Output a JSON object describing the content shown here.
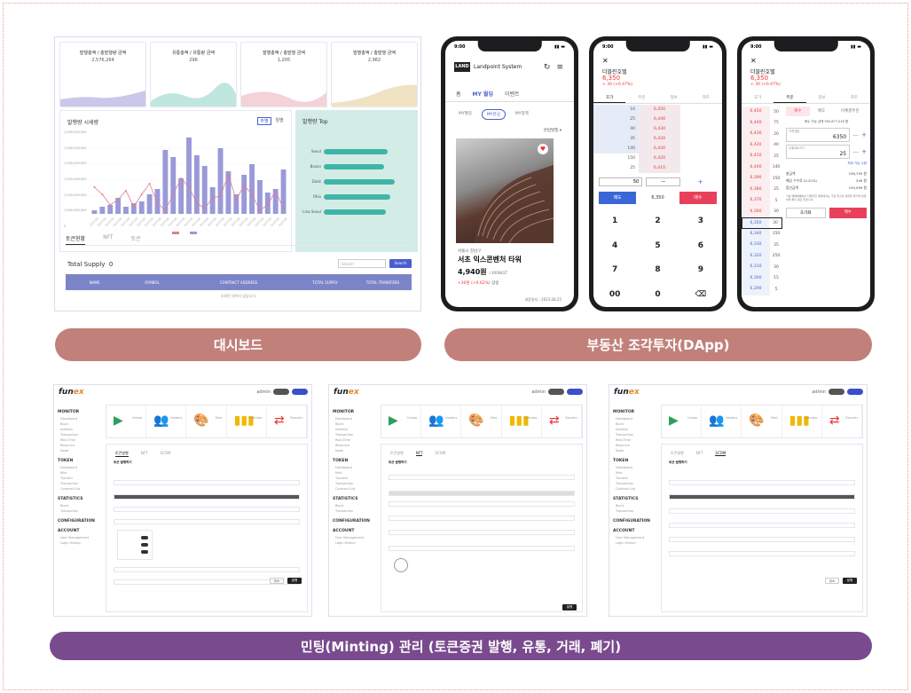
{
  "captions": {
    "dashboard": "대시보드",
    "dapp": "부동산 조각투자(DApp)",
    "minting": "민팅(Minting) 관리 (토큰증권 발행, 유통, 거래, 폐기)"
  },
  "dashboard": {
    "kpis": [
      {
        "title": "발행총액 / 총발행량 금액",
        "value": "2,576,264"
      },
      {
        "title": "유통총액 / 유통량 금액",
        "value": "296"
      },
      {
        "title": "발행총액 / 총발행 금액",
        "value": "1,205"
      },
      {
        "title": "발행총액 / 총발행 금액",
        "value": "2,982"
      }
    ],
    "chart_title": "발행량 시세량",
    "toggle_a": "주별",
    "toggle_b": "월별",
    "top_title": "발행량 Top",
    "top_items": [
      {
        "label": "Seoul",
        "value": 0.72
      },
      {
        "label": "Busan",
        "value": 0.68
      },
      {
        "label": "Dokk",
        "value": 0.8
      },
      {
        "label": "Ohio",
        "value": 0.75
      },
      {
        "label": "Lina Seoul",
        "value": 0.7
      }
    ],
    "tabs": [
      "토큰현황",
      "NFT",
      "토큰"
    ],
    "total_supply_label": "Total Supply",
    "total_supply_value": "0",
    "search_placeholder": "Search",
    "search_btn": "Search",
    "columns": [
      "NAME",
      "SYMBOL",
      "CONTRACT ADDRESS",
      "TOTAL SUPPLY",
      "TOTAL TRANSFERS"
    ],
    "empty": "조회된 데이터 없습니다."
  },
  "phone1": {
    "time": "9:00",
    "brand": "Landpoint System",
    "logo": "LAND",
    "tabs": [
      "홈",
      "MY 월딩",
      "이벤트"
    ],
    "sub": [
      "MY월딩",
      "MY관심",
      "MY정책"
    ],
    "filter": "관련발행 ▾",
    "location": "서울시 강남구",
    "name": "서초 익스콘벤처 타워",
    "price": "4,940원",
    "price_unit": "/ 400NLST",
    "change": "+30원 (+0.62%)",
    "change_tag": "상승",
    "date": "개장일자 : 2023.08.25"
  },
  "phone2": {
    "time": "9:00",
    "close": "✕",
    "name": "더블린호텔",
    "price": "6,350",
    "change": "+ 30 (+0.47%)",
    "tabs": [
      "호가",
      "주문",
      "정보",
      "차트"
    ],
    "orderbook": [
      {
        "qty": "16",
        "price": "6,450"
      },
      {
        "qty": "25",
        "price": "6,440"
      },
      {
        "qty": "40",
        "price": "6,430"
      },
      {
        "qty": "35",
        "price": "6,420"
      },
      {
        "qty": "140",
        "price": "6,430"
      },
      {
        "qty": "150",
        "price": "6,420"
      },
      {
        "qty": "25",
        "price": "6,410"
      }
    ],
    "qty_value": "50",
    "minus": "—",
    "plus": "+",
    "sell": "매도",
    "mid": "6,350",
    "buy": "매수",
    "keys": [
      "1",
      "2",
      "3",
      "4",
      "5",
      "6",
      "7",
      "8",
      "9",
      "00",
      "0",
      "⌫"
    ]
  },
  "phone3": {
    "time": "9:00",
    "close": "✕",
    "name": "더블린호텔",
    "price": "6,350",
    "change": "+ 30 (+0.47%)",
    "tabs": [
      "호가",
      "주문",
      "정보",
      "차트"
    ],
    "order_tabs": [
      "매수",
      "매도",
      "미체결주문"
    ],
    "available": "매수 가능 금액 905,877,018 원",
    "price_label": "가격(원)",
    "price_value": "6350",
    "qty_label": "수량(NLST)",
    "qty_value": "25",
    "max_label": "최대 가능 수량",
    "rows": [
      {
        "k": "총금액",
        "v": "158,750 원"
      },
      {
        "k": "예상 수수료 (0.22%)",
        "v": "349 원"
      },
      {
        "k": "합산금액",
        "v": "159,099 원"
      }
    ],
    "note": "가상 매매체결에서 다루어진 매칭에서는 가장 최고의 대금을 제거해 반영하여 확인 필요 있습니다.",
    "reset": "초기화",
    "buy": "매수",
    "book_prices": [
      "6,450",
      "6,440",
      "6,430",
      "6,420",
      "6,410",
      "6,400",
      "6,390",
      "6,380",
      "6,370",
      "6,360",
      "6,350",
      "6,340",
      "6,330",
      "6,320",
      "6,310",
      "6,300",
      "6,290"
    ],
    "book_qty": [
      "50",
      "75",
      "20",
      "40",
      "25",
      "140",
      "150",
      "25",
      "5",
      "30",
      "30",
      "150",
      "35",
      "250",
      "30",
      "15",
      "5"
    ]
  },
  "admin": {
    "logo_a": "fun",
    "logo_b": "ex",
    "side": [
      {
        "h": "MONITOR",
        "items": [
          "Dashboard",
          "Block",
          "Address",
          "Transaction",
          "Real-Time",
          "Resource",
          "Node"
        ]
      },
      {
        "h": "TOKEN",
        "items": [
          "Dashboard",
          "Mint",
          "Transfer",
          "Transaction",
          "Contract List"
        ]
      },
      {
        "h": "STATISTICS",
        "items": [
          "Block",
          "Transaction"
        ]
      },
      {
        "h": "CONFIGURATION",
        "items": []
      },
      {
        "h": "ACCOUNT",
        "items": [
          "User Management",
          "Login History"
        ]
      }
    ],
    "cards": [
      "Create",
      "Holders",
      "Mint",
      "Operator",
      "Transfer"
    ],
    "tabs": [
      "토큰발행",
      "NFT",
      "SCOM"
    ],
    "section": "토큰 발행하기",
    "cancel": "취소",
    "ok": "발행"
  }
}
